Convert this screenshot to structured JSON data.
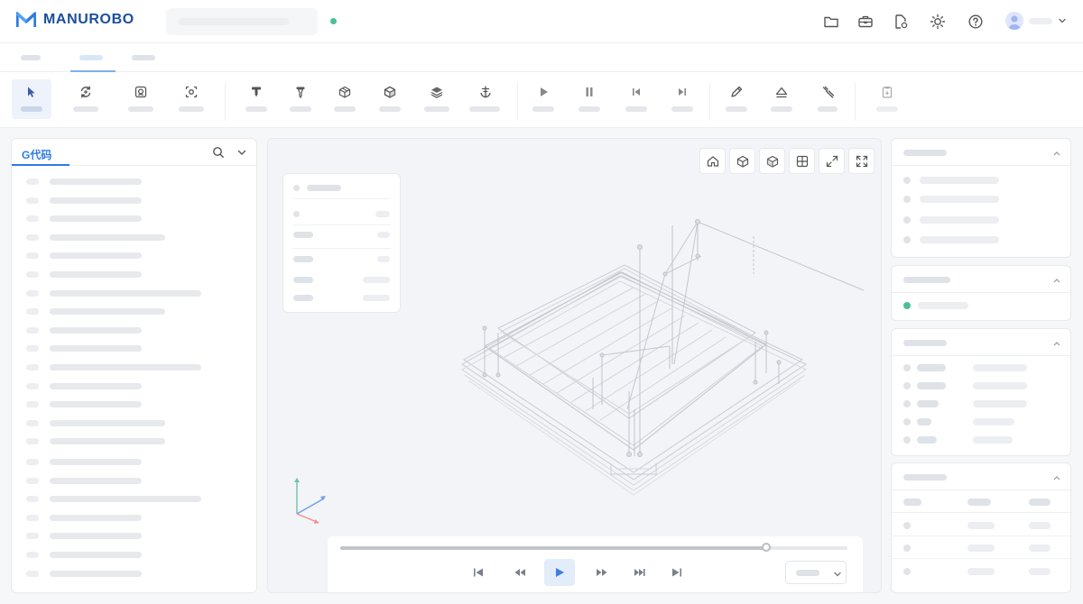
{
  "header": {
    "brand": "MANUROBO",
    "brand_color": "#1b4f9b",
    "connection_status_color": "#4cbf99",
    "icons": [
      "folder-icon",
      "toolbox-icon",
      "file-settings-icon",
      "sun-icon",
      "help-icon",
      "user-avatar-icon",
      "chevron-down-icon"
    ]
  },
  "toolbar": {
    "groups": [
      [
        "cursor-icon",
        "transform-icon",
        "scan-icon",
        "camera-capture-icon"
      ],
      [
        "nozzle-icon",
        "nozzle-alt-icon",
        "box-icon",
        "cube-icon",
        "layers-icon",
        "anchor-icon"
      ],
      [
        "play-icon",
        "pause-icon",
        "skip-back-icon",
        "skip-forward-icon"
      ],
      [
        "pen-icon",
        "eraser-icon",
        "tool-icon"
      ],
      [
        "clipboard-icon"
      ]
    ],
    "active_tool": "cursor-icon"
  },
  "left_panel": {
    "tab_label": "G代码",
    "accent_color": "#2f7be2",
    "icons": [
      "search-icon",
      "chevron-down-icon"
    ]
  },
  "viewport": {
    "view_buttons": [
      "home-view-icon",
      "cube-front-icon",
      "cube-iso-icon",
      "grid-view-icon",
      "expand-icon",
      "fullscreen-icon"
    ],
    "axis_colors": {
      "x": "#f08f8f",
      "y": "#6bc4a6",
      "z": "#6e9ee8"
    }
  },
  "player": {
    "progress": 0.84,
    "controls": [
      "skip-to-start-icon",
      "rewind-icon",
      "play-icon",
      "fast-forward-icon",
      "step-forward-icon",
      "skip-to-end-icon"
    ],
    "speed_dropdown_icon": "chevron-down-icon"
  }
}
